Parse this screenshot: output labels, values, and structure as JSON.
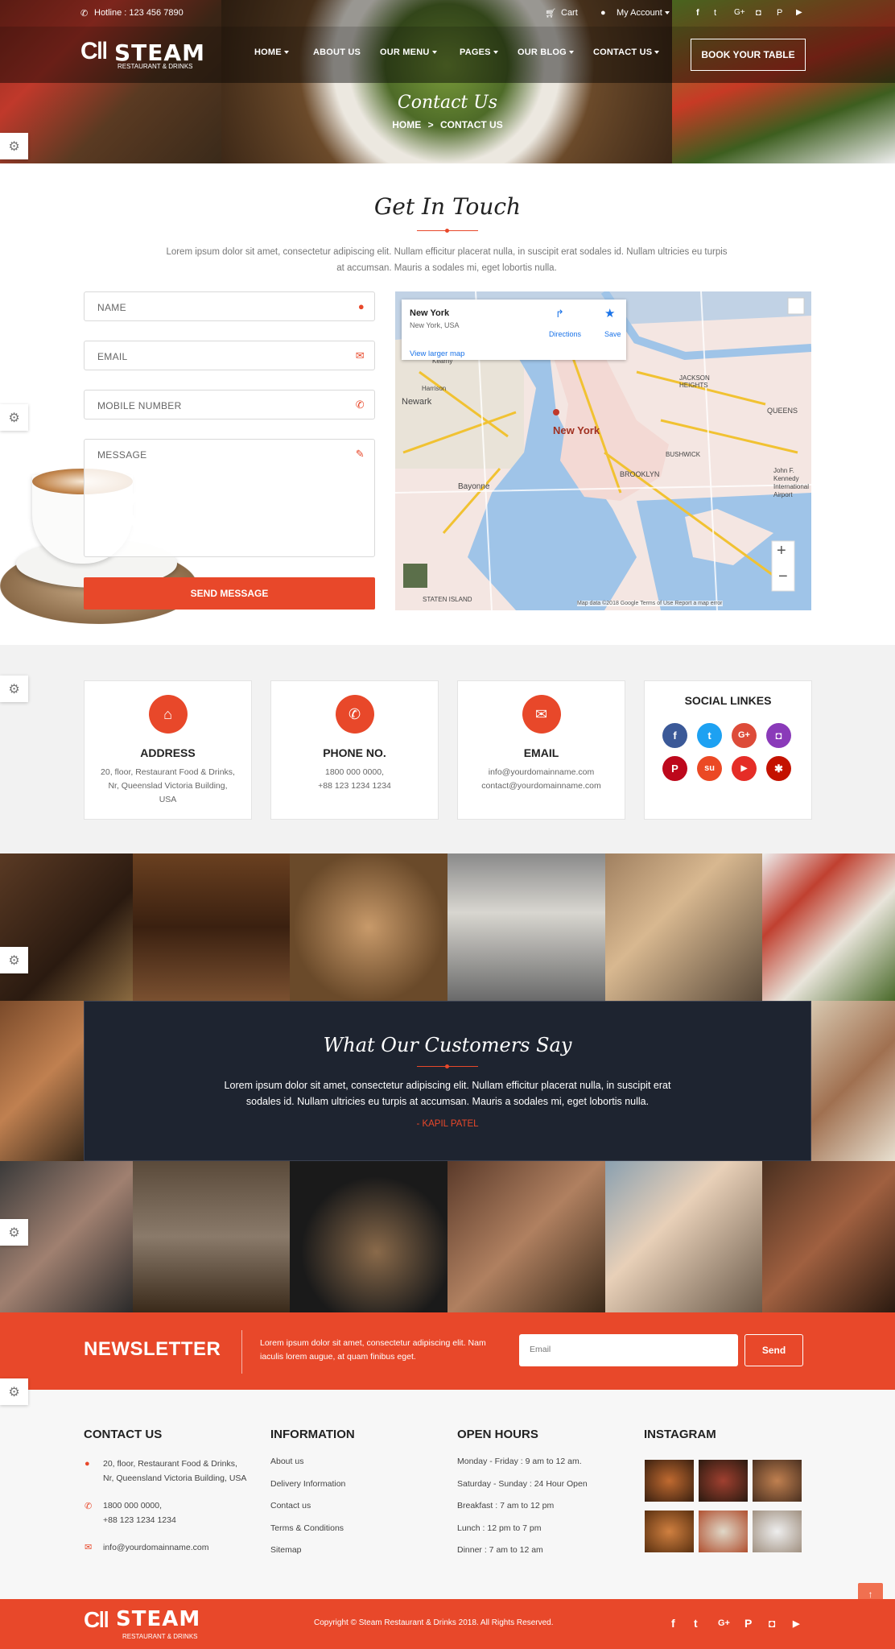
{
  "topbar": {
    "hotline": "Hotline : 123 456 7890",
    "cart": "Cart",
    "account": "My Account"
  },
  "brand": {
    "name": "STEAM",
    "tagline": "RESTAURANT & DRINKS"
  },
  "nav": {
    "items": [
      {
        "label": "HOME",
        "caret": true
      },
      {
        "label": "ABOUT US",
        "caret": false
      },
      {
        "label": "OUR MENU",
        "caret": true
      },
      {
        "label": "PAGES",
        "caret": true
      },
      {
        "label": "OUR BLOG",
        "caret": true
      },
      {
        "label": "CONTACT US",
        "caret": true
      }
    ],
    "book_label": "BOOK YOUR TABLE"
  },
  "hero": {
    "title": "Contact Us",
    "crumb_home": "HOME",
    "crumb_sep": ">",
    "crumb_current": "CONTACT US"
  },
  "contact": {
    "heading": "Get In Touch",
    "intro": "Lorem ipsum dolor sit amet, consectetur adipiscing elit. Nullam efficitur placerat nulla, in suscipit erat sodales id. Nullam ultricies eu turpis at accumsan. Mauris a sodales mi, eget lobortis nulla.",
    "name_ph": "NAME",
    "email_ph": "EMAIL",
    "mobile_ph": "MOBILE NUMBER",
    "message_ph": "MESSAGE",
    "send_label": "SEND MESSAGE"
  },
  "map": {
    "place": "New York",
    "place_sub": "New York, USA",
    "larger": "View larger map",
    "directions": "Directions",
    "save": "Save",
    "city_label": "New York",
    "labels": [
      "Newark",
      "Bayonne",
      "BROOKLYN",
      "QUEENS",
      "JACKSON HEIGHTS",
      "BUSHWICK",
      "STATEN ISLAND",
      "Harrison",
      "Kearny",
      "John F. Kennedy International Airport"
    ],
    "footer": "Map data ©2018 Google   Terms of Use   Report a map error"
  },
  "info_cards": [
    {
      "icon": "home-icon",
      "title": "ADDRESS",
      "lines": [
        "20, floor, Restaurant Food & Drinks,",
        "Nr, Queenslad Victoria Building,",
        "USA"
      ]
    },
    {
      "icon": "phone-icon",
      "title": "PHONE NO.",
      "lines": [
        "1800 000 0000,",
        "+88 123 1234 1234"
      ]
    },
    {
      "icon": "envelope-icon",
      "title": "EMAIL",
      "lines": [
        "info@yourdomainname.com",
        "contact@yourdomainname.com"
      ]
    }
  ],
  "social_card": {
    "title": "SOCIAL LINKES",
    "icons": [
      {
        "name": "facebook-icon",
        "glyph": "f",
        "color": "#3b5998"
      },
      {
        "name": "twitter-icon",
        "glyph": "t",
        "color": "#1da1f2"
      },
      {
        "name": "google-plus-icon",
        "glyph": "G+",
        "color": "#dd4b39"
      },
      {
        "name": "instagram-icon",
        "glyph": "◘",
        "color": "#8a3ab9"
      },
      {
        "name": "pinterest-icon",
        "glyph": "P",
        "color": "#bd081c"
      },
      {
        "name": "stumbleupon-icon",
        "glyph": "su",
        "color": "#eb4924"
      },
      {
        "name": "youtube-icon",
        "glyph": "▶",
        "color": "#e52d27"
      },
      {
        "name": "yelp-icon",
        "glyph": "✱",
        "color": "#c41200"
      }
    ]
  },
  "testimonial": {
    "heading": "What Our Customers Say",
    "quote": "Lorem ipsum dolor sit amet, consectetur adipiscing elit. Nullam efficitur placerat nulla, in suscipit erat sodales id. Nullam ultricies eu turpis at accumsan. Mauris a sodales mi, eget lobortis nulla.",
    "author": "- KAPIL PATEL"
  },
  "newsletter": {
    "title": "NEWSLETTER",
    "text": "Lorem ipsum dolor sit amet, consectetur adipiscing elit. Nam iaculis lorem augue, at quam finibus eget.",
    "email_ph": "Email",
    "send_label": "Send"
  },
  "footer": {
    "contact_title": "CONTACT US",
    "address": [
      "20, floor, Restaurant Food & Drinks,",
      "Nr, Queensland Victoria Building, USA"
    ],
    "phones": [
      "1800 000 0000,",
      "+88 123 1234 1234"
    ],
    "email": "info@yourdomainname.com",
    "info_title": "INFORMATION",
    "info_links": [
      "About us",
      "Delivery Information",
      "Contact us",
      "Terms & Conditions",
      "Sitemap"
    ],
    "hours_title": "OPEN HOURS",
    "hours": [
      "Monday - Friday : 9 am to 12 am.",
      "Saturday - Sunday : 24 Hour Open",
      "Breakfast : 7 am to 12 pm",
      "Lunch : 12 pm to 7 pm",
      "Dinner : 7 am to 12 am"
    ],
    "insta_title": "INSTAGRAM",
    "copyright": "Copyright © Steam Restaurant & Drinks 2018. All Rights Reserved."
  },
  "colors": {
    "accent": "#e8482a",
    "dark": "#1e2430"
  }
}
